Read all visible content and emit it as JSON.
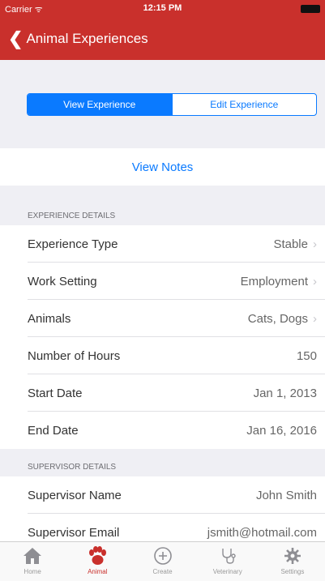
{
  "status_bar": {
    "carrier": "Carrier ᯤ",
    "time": "12:15 PM"
  },
  "nav": {
    "back_label": "Animal Experiences"
  },
  "segments": {
    "view": "View Experience",
    "edit": "Edit Experience"
  },
  "notes_link": "View Notes",
  "experience_section": {
    "header": "EXPERIENCE DETAILS",
    "rows": [
      {
        "label": "Experience Type",
        "value": "Stable"
      },
      {
        "label": "Work Setting",
        "value": "Employment"
      },
      {
        "label": "Animals",
        "value": "Cats, Dogs"
      },
      {
        "label": "Number of Hours",
        "value": "150"
      },
      {
        "label": "Start Date",
        "value": "Jan 1, 2013"
      },
      {
        "label": "End Date",
        "value": "Jan 16, 2016"
      }
    ]
  },
  "supervisor_section": {
    "header": "SUPERVISOR DETAILS",
    "rows": [
      {
        "label": "Supervisor Name",
        "value": "John Smith"
      },
      {
        "label": "Supervisor Email",
        "value": "jsmith@hotmail.com"
      }
    ]
  },
  "tabs": [
    {
      "label": "Home",
      "icon": "home-icon"
    },
    {
      "label": "Animal",
      "icon": "paw-icon"
    },
    {
      "label": "Create",
      "icon": "plus-circle-icon"
    },
    {
      "label": "Veterinary",
      "icon": "stethoscope-icon"
    },
    {
      "label": "Settings",
      "icon": "gear-icon"
    }
  ],
  "colors": {
    "accent": "#0a7aff",
    "brand": "#c9302c"
  }
}
